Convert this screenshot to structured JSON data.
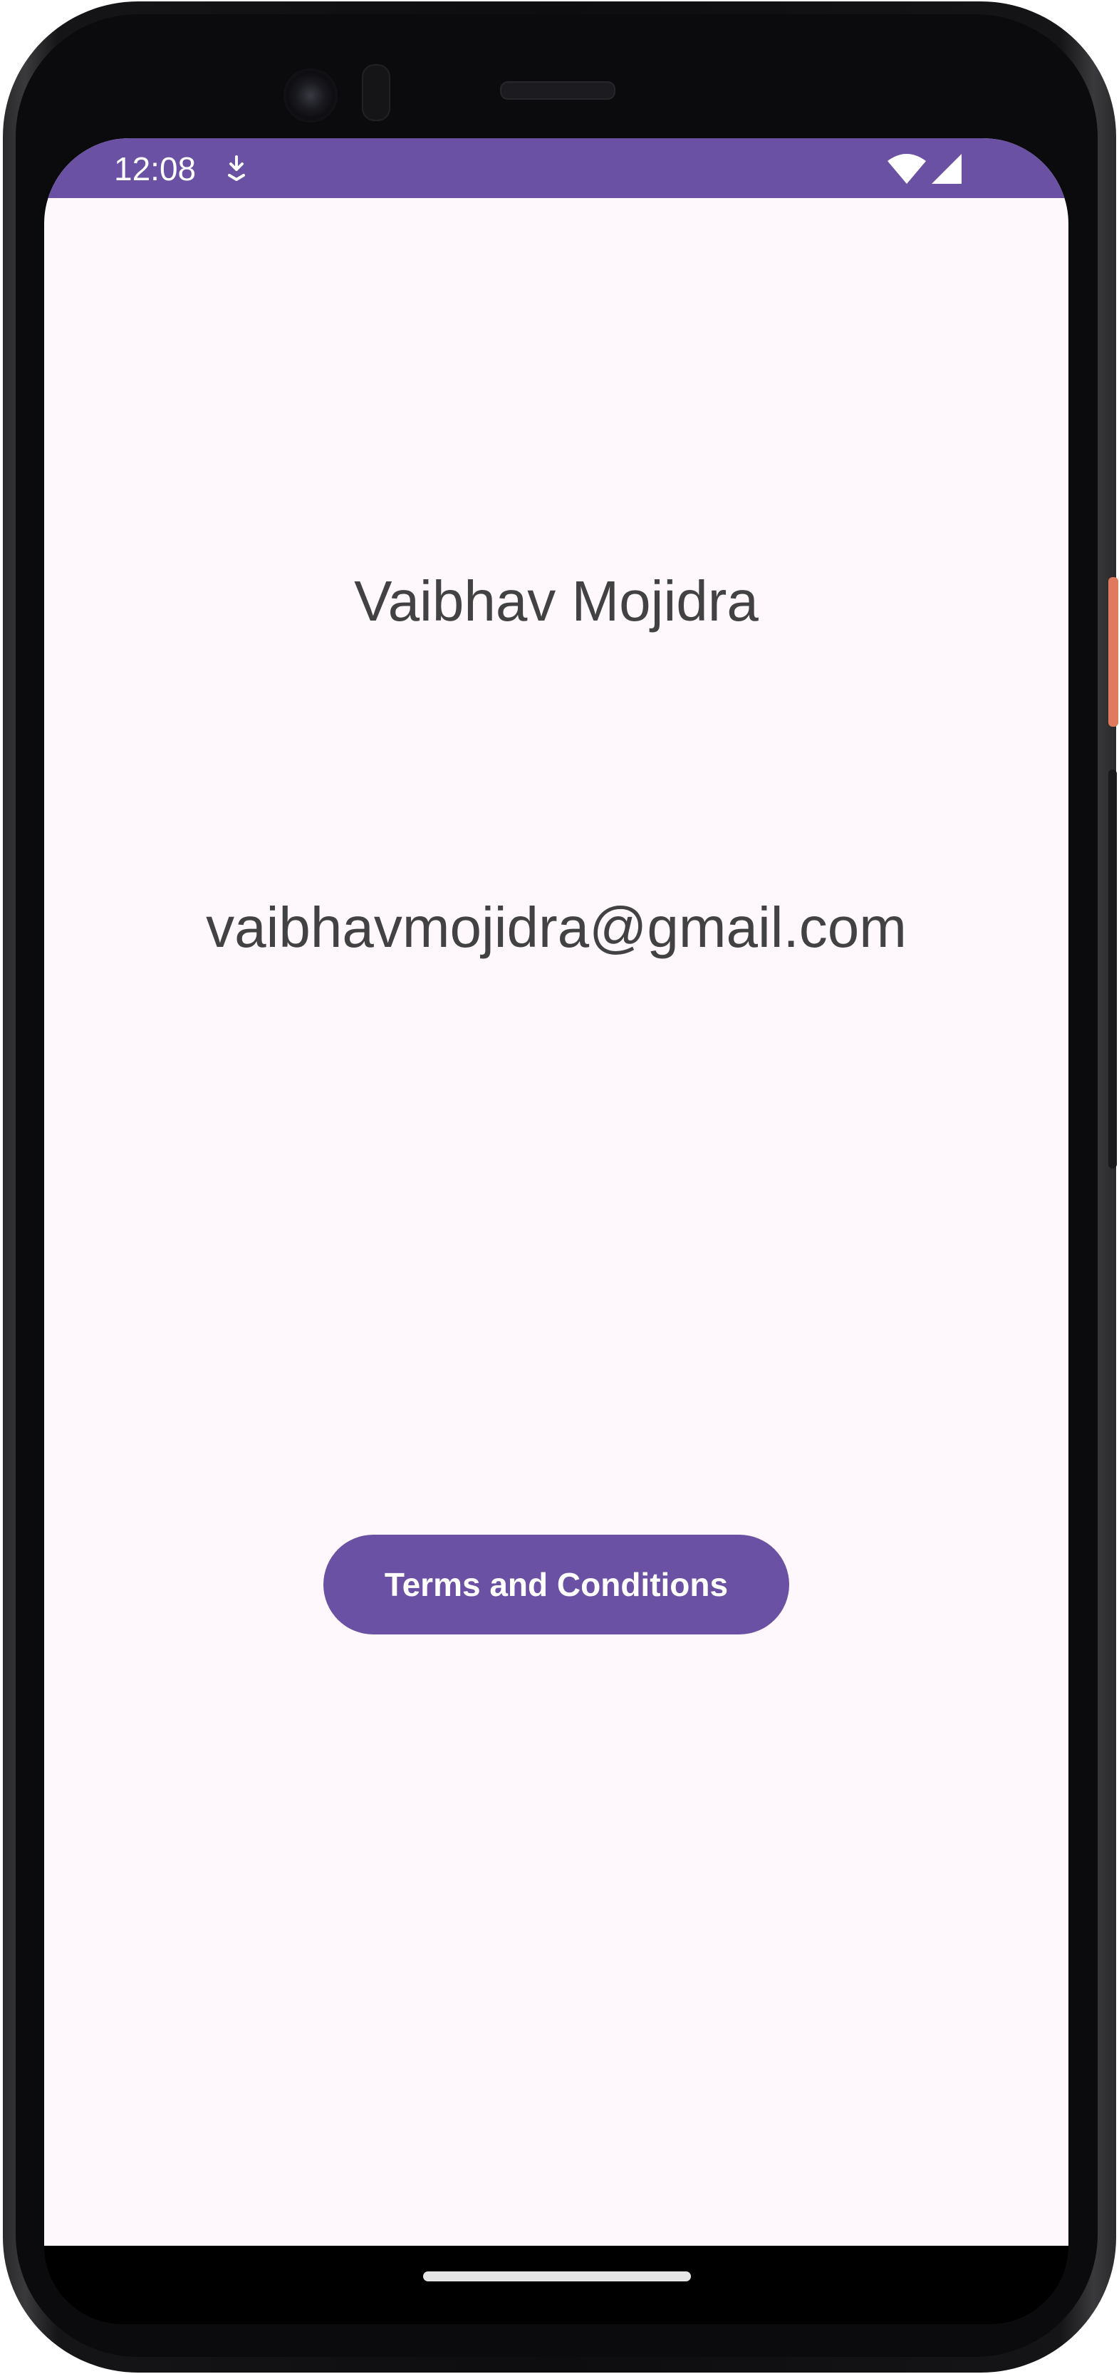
{
  "status_bar": {
    "time": "12:08",
    "notification_icon": "download-arrow-icon",
    "wifi_icon": "wifi-icon",
    "signal_icon": "cell-signal-icon",
    "color": "#6a51a3"
  },
  "profile": {
    "name": "Vaibhav Mojidra",
    "email": "vaibhavmojidra@gmail.com"
  },
  "actions": {
    "terms_label": "Terms and Conditions"
  },
  "theme": {
    "accent": "#6a51a3",
    "background": "#fef7fc",
    "text": "#424242"
  }
}
